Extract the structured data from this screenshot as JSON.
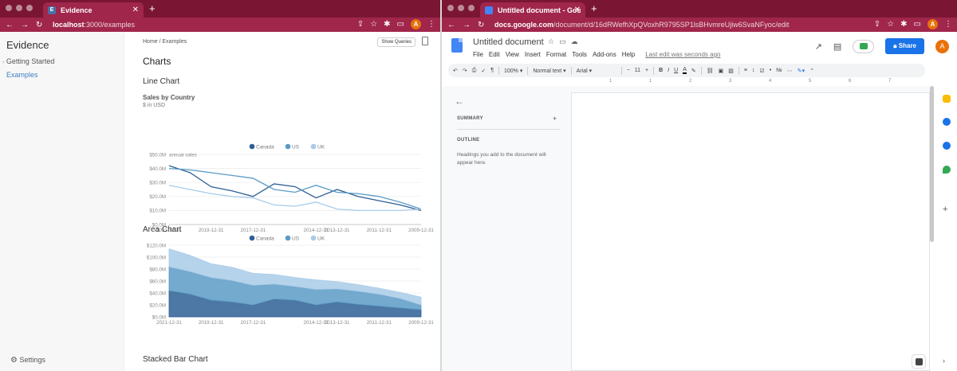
{
  "left_window": {
    "tab_title": "Evidence",
    "tab_favicon": "E",
    "url_host": "localhost",
    "url_path": ":3000/examples",
    "avatar_letter": "A",
    "sidebar": {
      "brand": "Evidence",
      "items": [
        {
          "label": "Getting Started",
          "active": false
        },
        {
          "label": "Examples",
          "active": true
        }
      ],
      "settings": "Settings"
    },
    "page": {
      "breadcrumb": "Home / Examples",
      "show_queries": "Show Queries",
      "title": "Charts",
      "line_section": "Line Chart",
      "line_title": "Sales by Country",
      "line_subtitle": "$ in USD",
      "area_section": "Area Chart",
      "stacked_section": "Stacked Bar Chart"
    }
  },
  "right_window": {
    "tab_title": "Untitled document - Google D",
    "url_host": "docs.google.com",
    "url_path": "/document/d/16dRWefhXpQVoxhR9795SP1lsBHvmreUjiw6SvaNFyoc/edit",
    "avatar_letter": "A",
    "doc_title": "Untitled document",
    "menu": [
      "File",
      "Edit",
      "View",
      "Insert",
      "Format",
      "Tools",
      "Add-ons",
      "Help"
    ],
    "last_edit": "Last edit was seconds ago",
    "share_label": "Share",
    "toolbar": {
      "zoom": "100%",
      "style": "Normal text",
      "font": "Arial",
      "size": "11",
      "bold": "B",
      "italic": "I",
      "underline": "U",
      "text_color": "A"
    },
    "ruler": [
      "1",
      "1",
      "2",
      "3",
      "4",
      "5",
      "6",
      "7"
    ],
    "outline": {
      "summary": "SUMMARY",
      "outline": "OUTLINE",
      "hint": "Headings you add to the document will appear here."
    }
  },
  "colors": {
    "chrome_tabbar": "#7a1634",
    "chrome_toolbar": "#a0264c",
    "canada": "#2e5f94",
    "us": "#5a9bc6",
    "uk": "#a9cbe9",
    "docs_blue": "#1a73e8"
  },
  "chart_data": [
    {
      "type": "line",
      "title": "Sales by Country",
      "subtitle": "$ in USD",
      "ylabel": "annual sales",
      "x": [
        "2021-12-31",
        "2020-12-31",
        "2019-12-31",
        "2018-12-31",
        "2017-12-31",
        "2016-12-31",
        "2015-12-31",
        "2014-12-31",
        "2013-12-31",
        "2012-12-31",
        "2011-12-31",
        "2010-12-31",
        "2009-12-31"
      ],
      "x_tick_labels": [
        "2021-12-31",
        "2019-12-31",
        "2017-12-31",
        "2014-12-31",
        "2013-12-31",
        "2011-12-31",
        "2009-12-31"
      ],
      "y_tick_labels": [
        "$0.0M",
        "$10.0M",
        "$20.0M",
        "$30.0M",
        "$40.0M",
        "$50.0M"
      ],
      "ylim": [
        0,
        50
      ],
      "legend": [
        "Canada",
        "US",
        "UK"
      ],
      "legend_position": "top-center",
      "series": [
        {
          "name": "Canada",
          "values": [
            42,
            37,
            27,
            24,
            20,
            29,
            27,
            19,
            25,
            20,
            17,
            14,
            10
          ]
        },
        {
          "name": "US",
          "values": [
            40,
            39,
            37,
            35,
            33,
            25,
            23,
            28,
            23,
            22,
            20,
            16,
            11
          ]
        },
        {
          "name": "UK",
          "values": [
            28,
            25,
            22,
            20,
            19,
            14,
            13,
            16,
            11,
            10,
            10,
            10,
            11
          ]
        }
      ]
    },
    {
      "type": "area",
      "x": [
        "2021-12-31",
        "2020-12-31",
        "2019-12-31",
        "2018-12-31",
        "2017-12-31",
        "2016-12-31",
        "2015-12-31",
        "2014-12-31",
        "2013-12-31",
        "2012-12-31",
        "2011-12-31",
        "2010-12-31",
        "2009-12-31"
      ],
      "x_tick_labels": [
        "2021-12-31",
        "2019-12-31",
        "2017-12-31",
        "2014-12-31",
        "2013-12-31",
        "2011-12-31",
        "2009-12-31"
      ],
      "y_tick_labels": [
        "$0.0M",
        "$20.0M",
        "$40.0M",
        "$60.0M",
        "$80.0M",
        "$100.0M",
        "$120.0M"
      ],
      "ylim": [
        0,
        120
      ],
      "stacked": true,
      "legend": [
        "Canada",
        "US",
        "UK"
      ],
      "legend_position": "top-center",
      "series": [
        {
          "name": "Canada",
          "values": [
            44,
            38,
            28,
            25,
            20,
            30,
            28,
            20,
            25,
            21,
            18,
            15,
            12
          ]
        },
        {
          "name": "US",
          "values": [
            40,
            38,
            38,
            36,
            33,
            25,
            23,
            26,
            22,
            22,
            20,
            16,
            8
          ]
        },
        {
          "name": "UK",
          "values": [
            30,
            27,
            23,
            22,
            20,
            16,
            15,
            16,
            12,
            11,
            10,
            10,
            13
          ]
        }
      ]
    }
  ]
}
